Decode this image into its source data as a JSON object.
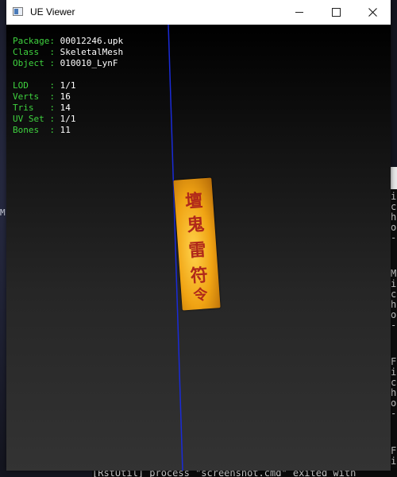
{
  "window": {
    "title": "UE Viewer",
    "buttons": {
      "minimize": "minimize",
      "maximize": "maximize",
      "close": "close"
    }
  },
  "info": {
    "package_key": "Package:",
    "package_val": "00012246.upk",
    "class_key": "Class  :",
    "class_val": "SkeletalMesh",
    "object_key": "Object :",
    "object_val": "010010_LynF",
    "lod_key": "LOD    :",
    "lod_val": "1/1",
    "verts_key": "Verts  :",
    "verts_val": "16",
    "tris_key": "Tris   :",
    "tris_val": "14",
    "uvset_key": "UV Set :",
    "uvset_val": "1/1",
    "bones_key": "Bones  :",
    "bones_val": "11"
  },
  "console": {
    "lines": [
      "i",
      "c",
      "h",
      "o",
      "-",
      "M",
      "i",
      "c",
      "h",
      "o",
      "-",
      "F",
      "i",
      "c",
      "h",
      "o",
      "-",
      "F",
      "i"
    ],
    "bottom": "[RstUtil] process \"screenshot.cmd\" exited with"
  },
  "desktop": {
    "left_letter": "M"
  },
  "colors": {
    "axis": "#1a2bd8",
    "info_key": "#3fd33f",
    "info_val": "#ffffff",
    "talisman": "#f0a313"
  },
  "icons": [
    "app-window-icon",
    "minimize-icon",
    "maximize-icon",
    "close-icon"
  ]
}
